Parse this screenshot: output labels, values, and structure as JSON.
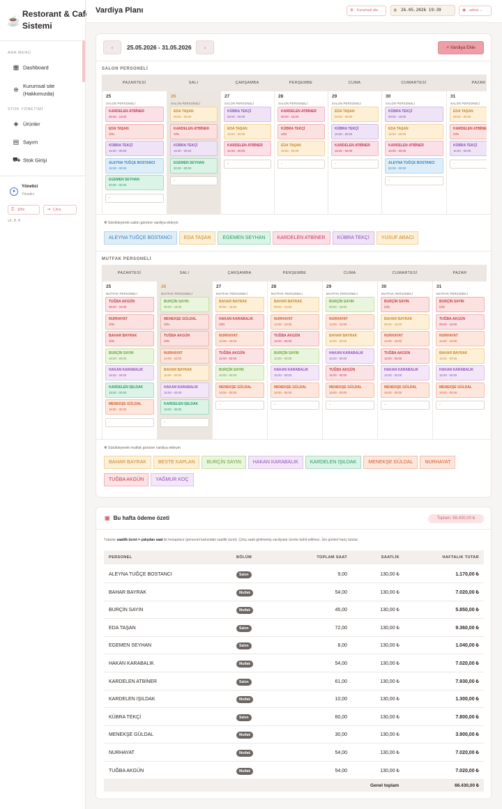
{
  "brand": {
    "title": "Restorant & Cafe Sistemi",
    "logo_icon": "coffee-cup-icon"
  },
  "sidebar": {
    "menu_label": "ANA MENÜ",
    "stock_label": "STOK YÖNETİMİ",
    "items": [
      {
        "label": "Dashboard",
        "icon": "grid-icon"
      },
      {
        "label": "Kurumsal site (Hakkımızda)",
        "icon": "globe-icon"
      },
      {
        "label": "Ürünler",
        "icon": "box-icon"
      },
      {
        "label": "Sayım",
        "icon": "clipboard-icon"
      },
      {
        "label": "Stok Girişi",
        "icon": "truck-icon"
      }
    ],
    "user": {
      "name": "Yönetici",
      "role": "Yönetici"
    },
    "pass_label": "Şifre",
    "logout_label": "Çıkış",
    "version": "v1.0.0"
  },
  "topbar": {
    "title": "Vardiya Planı",
    "site_label": "Kurumsal site",
    "datetime": "26.05.2026 19:39",
    "user_label": "admin"
  },
  "plan": {
    "range": "25.05.2026 - 31.05.2026",
    "add_label": "+ Vardiya Ekle",
    "days": [
      "PAZARTESİ",
      "SALI",
      "ÇARŞAMBA",
      "PERŞEMBE",
      "CUMA",
      "CUMARTESİ",
      "PAZAR"
    ],
    "dates": [
      "25",
      "26",
      "27",
      "28",
      "29",
      "30",
      "31"
    ],
    "add_box": "-",
    "salon": {
      "title": "SALON PERSONELİ",
      "sub": "SALON PERSONELİ",
      "hint": "Sürükleyerek salon gününe vardiya ekleyin",
      "cols": [
        [
          {
            "n": "KARDELEN ATBİNER",
            "t": "09:00 - 15:00",
            "c": "pink"
          },
          {
            "n": "EDA TAŞAN",
            "t": "İZİN",
            "c": "red"
          },
          {
            "n": "KÜBRA TEKÇİ",
            "t": "15:00 - 00:00",
            "c": "purple"
          },
          {
            "n": "ALEYNA TUĞÇE BOSTANCI",
            "t": "16:00 - 00:00",
            "c": "blue"
          },
          {
            "n": "EGEMEN SEYHAN",
            "t": "20:00 - 00:00",
            "c": "green"
          }
        ],
        [
          {
            "n": "EDA TAŞAN",
            "t": "09:00 - 00:00",
            "c": "orange"
          },
          {
            "n": "KARDELEN ATBİNER",
            "t": "İZİN",
            "c": "red"
          },
          {
            "n": "KÜBRA TEKÇİ",
            "t": "15:00 - 00:00",
            "c": "purple"
          },
          {
            "n": "EGEMEN SEYHAN",
            "t": "20:00 - 00:00",
            "c": "green"
          }
        ],
        [
          {
            "n": "KÜBRA TEKÇİ",
            "t": "09:00 - 00:00",
            "c": "purple"
          },
          {
            "n": "EDA TAŞAN",
            "t": "15:00 - 00:00",
            "c": "orange"
          },
          {
            "n": "KARDELEN ATBİNER",
            "t": "15:00 - 00:00",
            "c": "pink"
          }
        ],
        [
          {
            "n": "KARDELEN ATBİNER",
            "t": "09:00 - 15:00",
            "c": "pink"
          },
          {
            "n": "KÜBRA TEKÇİ",
            "t": "İZİN",
            "c": "red"
          },
          {
            "n": "EDA TAŞAN",
            "t": "15:00 - 00:00",
            "c": "orange"
          }
        ],
        [
          {
            "n": "EDA TAŞAN",
            "t": "09:00 - 00:00",
            "c": "orange"
          },
          {
            "n": "KÜBRA TEKÇİ",
            "t": "15:00 - 00:00",
            "c": "purple"
          },
          {
            "n": "KARDELEN ATBİNER",
            "t": "15:00 - 00:00",
            "c": "pink"
          }
        ],
        [
          {
            "n": "KÜBRA TEKÇİ",
            "t": "09:00 - 18:00",
            "c": "purple"
          },
          {
            "n": "EDA TAŞAN",
            "t": "15:00 - 00:00",
            "c": "orange"
          },
          {
            "n": "KARDELEN ATBİNER",
            "t": "15:00 - 00:00",
            "c": "pink"
          },
          {
            "n": "ALEYNA TUĞÇE BOSTANCI",
            "t": "20:00 - 00:00",
            "c": "blue"
          }
        ],
        [
          {
            "n": "EDA TAŞAN",
            "t": "09:00 - 00:00",
            "c": "orange"
          },
          {
            "n": "KARDELEN ATBİNER",
            "t": "İZİN",
            "c": "red"
          },
          {
            "n": "KÜBRA TEKÇİ",
            "t": "15:00 - 00:00",
            "c": "purple"
          }
        ]
      ],
      "pool": [
        {
          "n": "ALEYNA TUĞÇE BOSTANCI",
          "c": "blue"
        },
        {
          "n": "EDA TAŞAN",
          "c": "orange"
        },
        {
          "n": "EGEMEN SEYHAN",
          "c": "green"
        },
        {
          "n": "KARDELEN ATBİNER",
          "c": "pink"
        },
        {
          "n": "KÜBRA TEKÇİ",
          "c": "purple"
        },
        {
          "n": "YUSUF ARACI",
          "c": "orange"
        }
      ]
    },
    "mutfak": {
      "title": "MUTFAK PERSONELİ",
      "sub": "MUTFAK PERSONELİ",
      "hint": "Sürükleyerek mutfak gününe vardiya ekleyin",
      "cols": [
        [
          {
            "n": "TUĞBA AKGÜN",
            "t": "09:00 - 15:00",
            "c": "rose"
          },
          {
            "n": "NURHAYAT",
            "t": "İZİN",
            "c": "red"
          },
          {
            "n": "BAHAR BAYRAK",
            "t": "İZİN",
            "c": "red"
          },
          {
            "n": "BURÇİN SAYIN",
            "t": "15:00 - 00:00",
            "c": "lgreen"
          },
          {
            "n": "HAKAN KARABALIK",
            "t": "15:00 - 00:00",
            "c": "lav"
          },
          {
            "n": "KARDELEN IŞILDAK",
            "t": "19:00 - 00:00",
            "c": "green"
          },
          {
            "n": "MENEKŞE GÜLDAL",
            "t": "19:00 - 00:00",
            "c": "salmon"
          }
        ],
        [
          {
            "n": "BURÇİN SAYIN",
            "t": "09:00 - 18:00",
            "c": "lgreen"
          },
          {
            "n": "MENEKŞE GÜLDAL",
            "t": "İZİN",
            "c": "red"
          },
          {
            "n": "TUĞBA AKGÜN",
            "t": "İZİN",
            "c": "red"
          },
          {
            "n": "NURHAYAT",
            "t": "14:00 - 23:00",
            "c": "salmon"
          },
          {
            "n": "BAHAR BAYRAK",
            "t": "15:00 - 00:00",
            "c": "orange"
          },
          {
            "n": "HAKAN KARABALIK",
            "t": "15:00 - 00:00",
            "c": "lav"
          },
          {
            "n": "KARDELEN IŞILDAK",
            "t": "19:00 - 00:00",
            "c": "green"
          }
        ],
        [
          {
            "n": "BAHAR BAYRAK",
            "t": "09:00 - 15:00",
            "c": "orange"
          },
          {
            "n": "HAKAN KARABALIK",
            "t": "İZİN",
            "c": "red"
          },
          {
            "n": "NURHAYAT",
            "t": "14:00 - 23:00",
            "c": "salmon"
          },
          {
            "n": "TUĞBA AKGÜN",
            "t": "15:00 - 00:00",
            "c": "rose"
          },
          {
            "n": "BURÇİN SAYIN",
            "t": "15:00 - 00:00",
            "c": "lgreen"
          },
          {
            "n": "MENEKŞE GÜLDAL",
            "t": "19:00 - 00:00",
            "c": "salmon"
          }
        ],
        [
          {
            "n": "BAHAR BAYRAK",
            "t": "09:00 - 15:00",
            "c": "orange"
          },
          {
            "n": "NURHAYAT",
            "t": "14:00 - 23:00",
            "c": "salmon"
          },
          {
            "n": "TUĞBA AKGÜN",
            "t": "15:00 - 00:00",
            "c": "rose"
          },
          {
            "n": "BURÇİN SAYIN",
            "t": "15:00 - 00:00",
            "c": "lgreen"
          },
          {
            "n": "HAKAN KARABALIK",
            "t": "15:00 - 00:00",
            "c": "lav"
          },
          {
            "n": "MENEKŞE GÜLDAL",
            "t": "19:00 - 00:00",
            "c": "salmon"
          }
        ],
        [
          {
            "n": "BURÇİN SAYIN",
            "t": "09:00 - 18:00",
            "c": "lgreen"
          },
          {
            "n": "NURHAYAT",
            "t": "14:00 - 23:00",
            "c": "salmon"
          },
          {
            "n": "BAHAR BAYRAK",
            "t": "15:00 - 00:00",
            "c": "orange"
          },
          {
            "n": "HAKAN KARABALIK",
            "t": "15:00 - 00:00",
            "c": "lav"
          },
          {
            "n": "TUĞBA AKGÜN",
            "t": "15:00 - 00:00",
            "c": "rose"
          },
          {
            "n": "MENEKŞE GÜLDAL",
            "t": "19:00 - 00:00",
            "c": "salmon"
          }
        ],
        [
          {
            "n": "BURÇİN SAYIN",
            "t": "İZİN",
            "c": "red"
          },
          {
            "n": "BAHAR BAYRAK",
            "t": "09:00 - 15:00",
            "c": "orange"
          },
          {
            "n": "NURHAYAT",
            "t": "14:00 - 23:00",
            "c": "salmon"
          },
          {
            "n": "TUĞBA AKGÜN",
            "t": "15:00 - 00:00",
            "c": "rose"
          },
          {
            "n": "HAKAN KARABALIK",
            "t": "15:00 - 00:00",
            "c": "lav"
          },
          {
            "n": "MENEKŞE GÜLDAL",
            "t": "19:00 - 00:00",
            "c": "salmon"
          }
        ],
        [
          {
            "n": "BURÇİN SAYIN",
            "t": "İZİN",
            "c": "red"
          },
          {
            "n": "TUĞBA AKGÜN",
            "t": "09:00 - 18:00",
            "c": "rose"
          },
          {
            "n": "NURHAYAT",
            "t": "14:00 - 23:00",
            "c": "salmon"
          },
          {
            "n": "BAHAR BAYRAK",
            "t": "15:00 - 00:00",
            "c": "orange"
          },
          {
            "n": "HAKAN KARABALIK",
            "t": "15:00 - 00:00",
            "c": "lav"
          },
          {
            "n": "MENEKŞE GÜLDAL",
            "t": "19:00 - 00:00",
            "c": "salmon"
          }
        ]
      ],
      "pool": [
        {
          "n": "BAHAR BAYRAK",
          "c": "orange"
        },
        {
          "n": "BESTE KAPLAN",
          "c": "orange"
        },
        {
          "n": "BURÇİN SAYIN",
          "c": "lgreen"
        },
        {
          "n": "HAKAN KARABALIK",
          "c": "lav"
        },
        {
          "n": "KARDELEN IŞILDAK",
          "c": "green"
        },
        {
          "n": "MENEKŞE GÜLDAL",
          "c": "salmon"
        },
        {
          "n": "NURHAYAT",
          "c": "salmon"
        },
        {
          "n": "TUĞBA AKGÜN",
          "c": "rose"
        },
        {
          "n": "YAĞMUR KOÇ",
          "c": "lav"
        }
      ]
    }
  },
  "payment": {
    "title": "Bu hafta ödeme özeti",
    "total_badge": "Toplam: 66.430,00 ₺",
    "note_prefix": "Tutarlar ",
    "note_bold": "saatlik ücret × çalışılan saat",
    "note_suffix": " ile hesaplanır (personel kartındaki saatlik ücret). Çıkış saati girilmemiş vardiyalar ücrete dahil edilmez. İzin günleri hariç tutulur.",
    "headers": [
      "PERSONEL",
      "BÖLÜM",
      "TOPLAM SAAT",
      "SAATLİK",
      "HAFTALIK TUTAR"
    ],
    "rows": [
      [
        "ALEYNA TUĞÇE BOSTANCI",
        "Salon",
        "9,00",
        "130,00 ₺",
        "1.170,00 ₺"
      ],
      [
        "BAHAR BAYRAK",
        "Mutfak",
        "54,00",
        "130,00 ₺",
        "7.020,00 ₺"
      ],
      [
        "BURÇİN SAYIN",
        "Mutfak",
        "45,00",
        "130,00 ₺",
        "5.850,00 ₺"
      ],
      [
        "EDA TAŞAN",
        "Salon",
        "72,00",
        "130,00 ₺",
        "9.360,00 ₺"
      ],
      [
        "EGEMEN SEYHAN",
        "Salon",
        "8,00",
        "130,00 ₺",
        "1.040,00 ₺"
      ],
      [
        "HAKAN KARABALIK",
        "Mutfak",
        "54,00",
        "130,00 ₺",
        "7.020,00 ₺"
      ],
      [
        "KARDELEN ATBİNER",
        "Salon",
        "61,00",
        "130,00 ₺",
        "7.930,00 ₺"
      ],
      [
        "KARDELEN IŞILDAK",
        "Mutfak",
        "10,00",
        "130,00 ₺",
        "1.300,00 ₺"
      ],
      [
        "KÜBRA TEKÇİ",
        "Salon",
        "60,00",
        "130,00 ₺",
        "7.800,00 ₺"
      ],
      [
        "MENEKŞE GÜLDAL",
        "Mutfak",
        "30,00",
        "130,00 ₺",
        "3.900,00 ₺"
      ],
      [
        "NURHAYAT",
        "Mutfak",
        "54,00",
        "130,00 ₺",
        "7.020,00 ₺"
      ],
      [
        "TUĞBA AKGÜN",
        "Mutfak",
        "54,00",
        "130,00 ₺",
        "7.020,00 ₺"
      ]
    ],
    "footer_label": "Genel toplam",
    "footer_total": "66.430,00 ₺"
  }
}
